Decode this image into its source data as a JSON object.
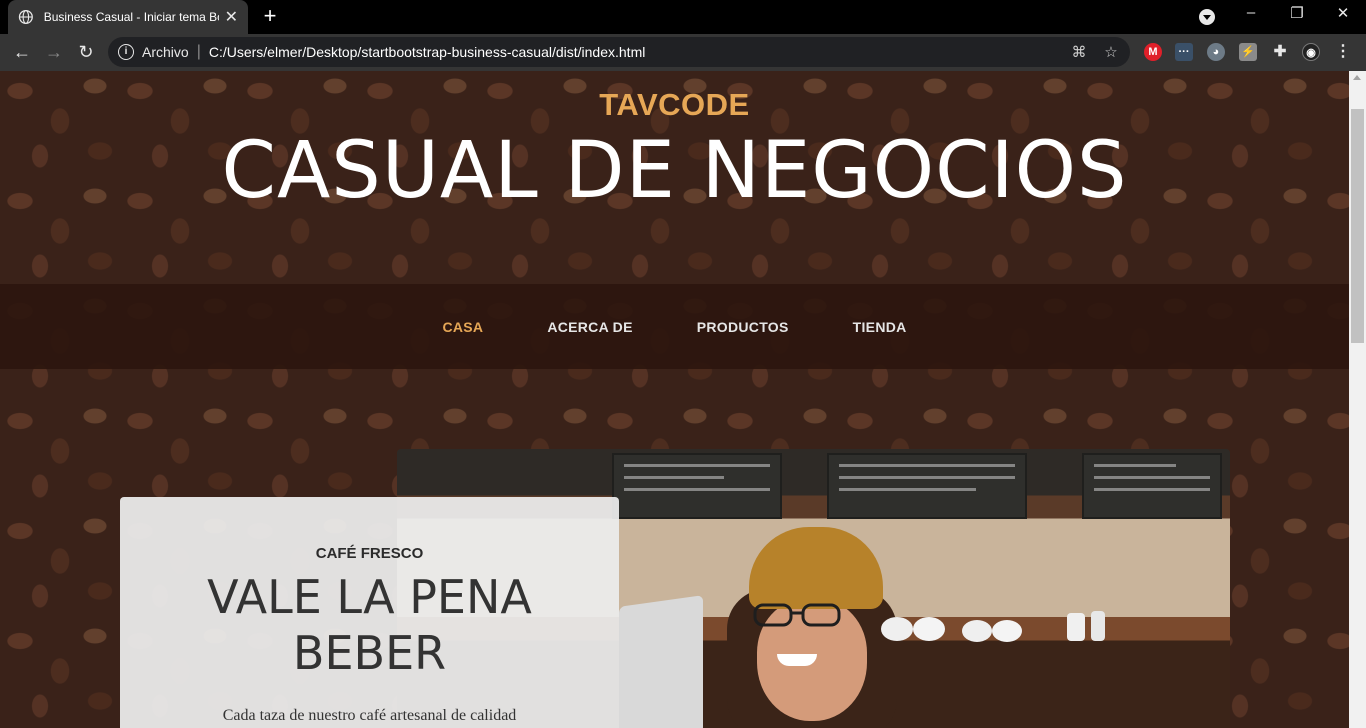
{
  "browser": {
    "tab_title": "Business Casual - Iniciar tema Bo",
    "scheme_label": "Archivo",
    "url": "C:/Users/elmer/Desktop/startbootstrap-business-casual/dist/index.html",
    "icons": [
      "globe-icon",
      "close-icon",
      "plus-icon",
      "back-icon",
      "forward-icon",
      "reload-icon",
      "info-icon",
      "translate-icon",
      "star-icon",
      "puzzle-icon",
      "menu-icon"
    ]
  },
  "site": {
    "heading_upper": "TAVCODE",
    "heading_lower": "CASUAL DE NEGOCIOS",
    "nav": [
      {
        "label": "CASA",
        "active": true
      },
      {
        "label": "ACERCA DE",
        "active": false
      },
      {
        "label": "PRODUCTOS",
        "active": false
      },
      {
        "label": "TIENDA",
        "active": false
      }
    ],
    "intro": {
      "upper": "CAFÉ FRESCO",
      "lower": "VALE LA PENA BEBER",
      "text": "Cada taza de nuestro café artesanal de calidad"
    }
  },
  "colors": {
    "accent": "#e6a756",
    "nav_bg": "#2d160e"
  }
}
